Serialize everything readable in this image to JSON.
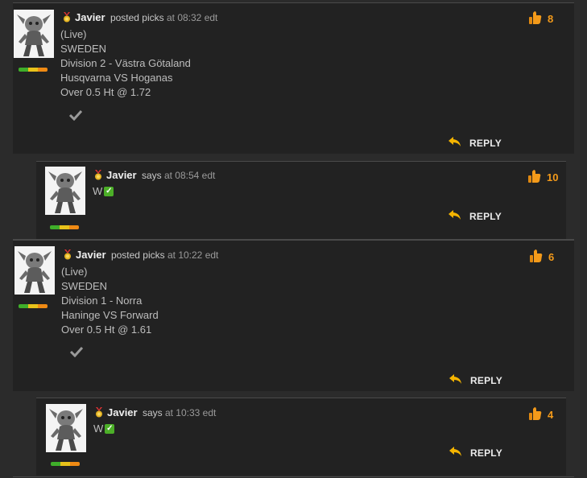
{
  "posts": [
    {
      "user": "Javier",
      "action": "posted picks",
      "time": "at 08:32 edt",
      "lines": [
        "(Live)",
        "SWEDEN",
        "Division 2 - Västra Götaland",
        "Husqvarna VS Hoganas",
        "Over 0.5 Ht @ 1.72"
      ],
      "likes": "8",
      "reply": "REPLY"
    },
    {
      "user": "Javier",
      "action": "says",
      "time": "at 08:54 edt",
      "text": "W",
      "check": "✓",
      "likes": "10",
      "reply": "REPLY"
    },
    {
      "user": "Javier",
      "action": "posted picks",
      "time": "at 10:22 edt",
      "lines": [
        "(Live)",
        "SWEDEN",
        "Division 1 - Norra",
        "Haninge VS Forward",
        "Over 0.5 Ht @ 1.61"
      ],
      "likes": "6",
      "reply": "REPLY"
    },
    {
      "user": "Javier",
      "action": "says",
      "time": "at 10:33 edt",
      "text": "W",
      "check": "✓",
      "likes": "4",
      "reply": "REPLY"
    }
  ],
  "icons": {
    "medal": "medal-icon",
    "like": "thumbs-up-icon",
    "reply": "reply-arrow-icon",
    "checkmark": "checkmark-icon",
    "avatar": "goblin-avatar"
  },
  "colors": {
    "like_count": "#f39a1a",
    "reply_arrow": "#f4b400",
    "green_check": "#4caf28"
  }
}
